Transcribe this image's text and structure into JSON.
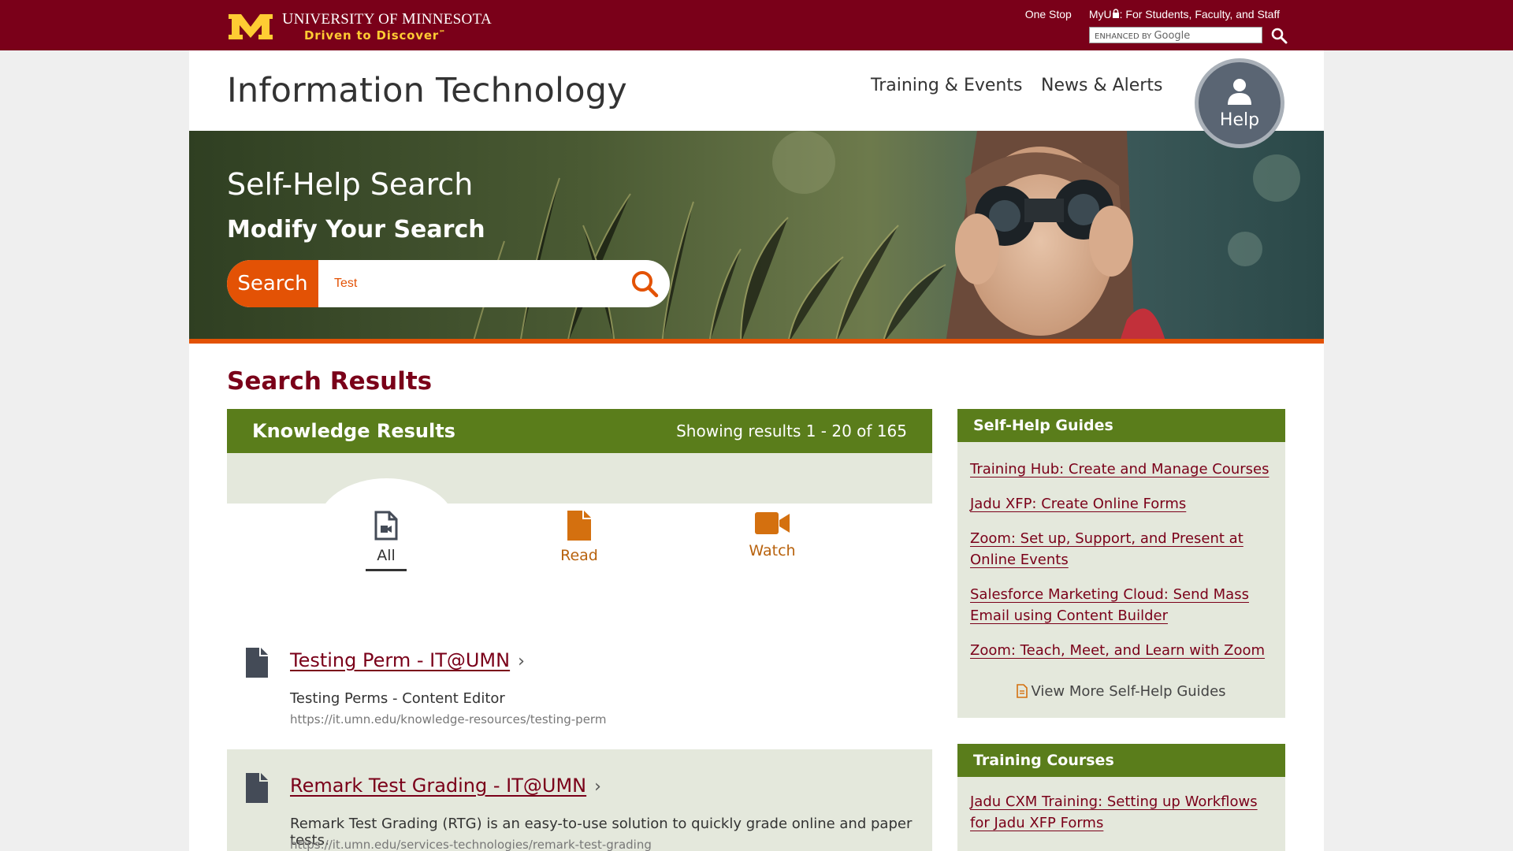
{
  "topbar": {
    "university_name_cap1": "U",
    "university_name_rest1": "NIVERSITY OF ",
    "university_name_cap2": "M",
    "university_name_rest2": "INNESOTA",
    "tagline": "Driven to Discover",
    "tagline_mark": "℠",
    "links": [
      "One Stop",
      "MyU",
      ": For Students, Faculty, and Staff"
    ],
    "google_prefix": "ENHANCED BY",
    "google_brand": "Google",
    "colors": {
      "maroon": "#7a0019",
      "gold": "#ffcc33"
    }
  },
  "header": {
    "site_title": "Information Technology",
    "nav": [
      "Training & Events",
      "News & Alerts"
    ],
    "help_label": "Help"
  },
  "hero": {
    "title": "Self-Help Search",
    "subtitle": "Modify Your Search",
    "search_label": "Search",
    "search_value": "Test"
  },
  "results": {
    "heading": "Search Results",
    "panel_title": "Knowledge Results",
    "count_text": "Showing results 1 - 20 of 165",
    "tabs": [
      {
        "label": "All",
        "icon": "all-media-icon",
        "active": true
      },
      {
        "label": "Read",
        "icon": "document-icon",
        "active": false
      },
      {
        "label": "Watch",
        "icon": "video-camera-icon",
        "active": false
      }
    ],
    "items": [
      {
        "title": "Testing Perm - IT@UMN",
        "desc": "Testing Perms - Content Editor",
        "url": "https://it.umn.edu/knowledge-resources/testing-perm"
      },
      {
        "title": "Remark Test Grading - IT@UMN",
        "desc": "Remark Test Grading (RTG) is an easy-to-use solution to quickly grade online and paper tests.",
        "url": "https://it.umn.edu/services-technologies/remark-test-grading"
      }
    ]
  },
  "sidebar": {
    "guides_title": "Self-Help Guides",
    "guides": [
      "Training Hub: Create and Manage Courses",
      "Jadu XFP: Create Online Forms",
      "Zoom: Set up, Support, and Present at Online Events",
      "Salesforce Marketing Cloud: Send Mass Email using Content Builder",
      "Zoom: Teach, Meet, and Learn with Zoom"
    ],
    "view_more": "View More Self-Help Guides",
    "courses_title": "Training Courses",
    "courses": [
      "Jadu CXM Training: Setting up Workflows for Jadu XFP Forms"
    ]
  },
  "theme": {
    "accent_orange": "#e35205",
    "panel_green": "#5a7d1b",
    "panel_tint": "#e4e8dc",
    "link_maroon": "#7a0019"
  }
}
